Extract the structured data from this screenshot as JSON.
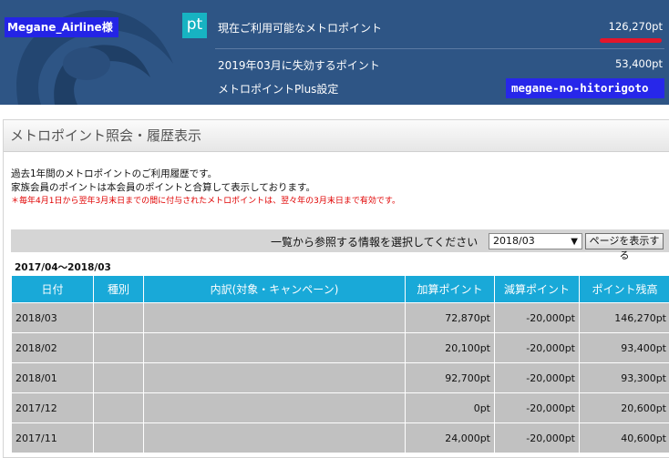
{
  "header": {
    "user_name": "Megane_Airline",
    "user_suffix": "様",
    "pt_icon": "pt",
    "rows": [
      {
        "label": "現在ご利用可能なメトロポイント",
        "value": "126,270pt"
      },
      {
        "label": "2019年03月に失効するポイント",
        "value": "53,400pt"
      },
      {
        "label": "メトロポイントPlus設定",
        "value": ""
      }
    ],
    "blog_tag": "megane-no-hitorigoto",
    "highlight_color": "#e4162b"
  },
  "panel": {
    "title": "メトロポイント照会・履歴表示",
    "desc_line1": "過去1年間のメトロポイントのご利用履歴です。",
    "desc_line2": "家族会員のポイントは本会員のポイントと合算して表示しております。",
    "note": "＊毎年4月1日から翌年3月末日までの間に付与されたメトロポイントは、翌々年の3月末日まで有効です。",
    "select_prompt": "一覧から参照する情報を選択してください",
    "select_value": "2018/03",
    "show_button": "ページを表示する",
    "period": "2017/04～2018/03"
  },
  "table": {
    "headers": [
      "日付",
      "種別",
      "内訳(対象・キャンペーン)",
      "加算ポイント",
      "減算ポイント",
      "ポイント残高"
    ],
    "rows": [
      {
        "date": "2018/03",
        "type": "",
        "detail": "",
        "add": "72,870pt",
        "sub": "-20,000pt",
        "balance": "146,270pt"
      },
      {
        "date": "2018/02",
        "type": "",
        "detail": "",
        "add": "20,100pt",
        "sub": "-20,000pt",
        "balance": "93,400pt"
      },
      {
        "date": "2018/01",
        "type": "",
        "detail": "",
        "add": "92,700pt",
        "sub": "-20,000pt",
        "balance": "93,300pt"
      },
      {
        "date": "2017/12",
        "type": "",
        "detail": "",
        "add": "0pt",
        "sub": "-20,000pt",
        "balance": "20,600pt"
      },
      {
        "date": "2017/11",
        "type": "",
        "detail": "",
        "add": "24,000pt",
        "sub": "-20,000pt",
        "balance": "40,600pt"
      }
    ]
  }
}
